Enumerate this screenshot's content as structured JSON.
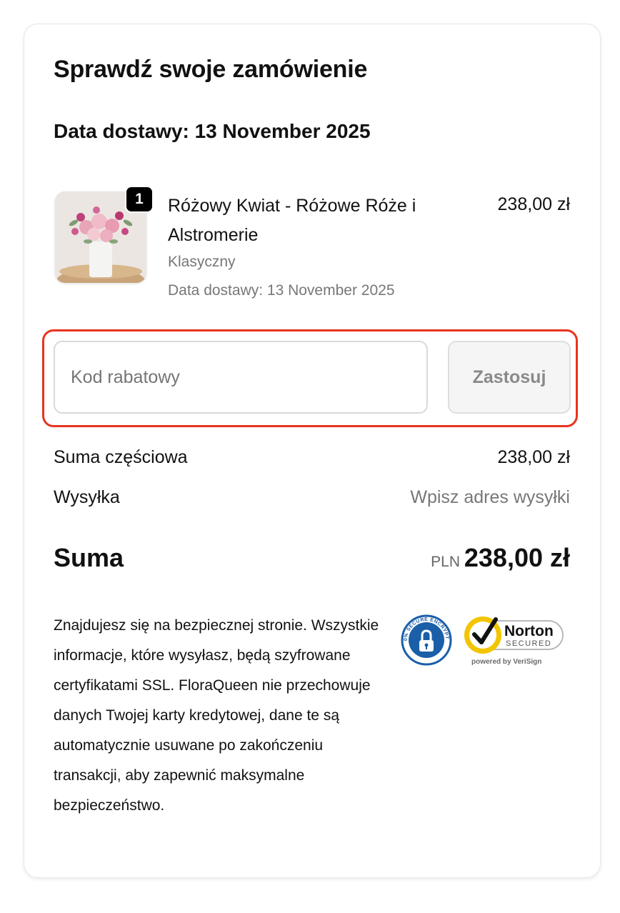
{
  "page": {
    "title": "Sprawdź swoje zamówienie",
    "delivery_heading": "Data dostawy: 13 November 2025"
  },
  "order_item": {
    "quantity": "1",
    "name": "Różowy Kwiat - Różowe Róże i Alstromerie",
    "variant": "Klasyczny",
    "delivery_date": "Data dostawy: 13 November 2025",
    "price": "238,00 zł"
  },
  "discount": {
    "placeholder": "Kod rabatowy",
    "apply_label": "Zastosuj"
  },
  "summary": {
    "subtotal_label": "Suma częściowa",
    "subtotal_value": "238,00 zł",
    "shipping_label": "Wysyłka",
    "shipping_value": "Wpisz adres wysyłki",
    "total_label": "Suma",
    "total_currency": "PLN",
    "total_value": "238,00 zł"
  },
  "security": {
    "text": "Znajdujesz się na bezpiecznej stronie. Wszystkie informacje, które wysyłasz, będą szyfrowane certyfikatami SSL. FloraQueen nie przechowuje danych Twojej karty kredytowej, dane te są automatycznie usuwane po zakończeniu transakcji, aby zapewnić maksymalne bezpieczeństwo.",
    "seal_secure_text": "100% SECURE ENCRYPTED",
    "seal_norton_brand": "Norton",
    "seal_norton_secured": "SECURED",
    "seal_norton_powered": "powered by VeriSign"
  },
  "colors": {
    "highlight_border": "#e8331f",
    "secure_seal_blue": "#1a5fa8",
    "norton_yellow": "#f2c500"
  },
  "icons": {
    "product_image": "flower-bouquet-image",
    "secure_seal": "padlock-seal-icon",
    "norton_seal": "norton-checkmark-icon"
  }
}
